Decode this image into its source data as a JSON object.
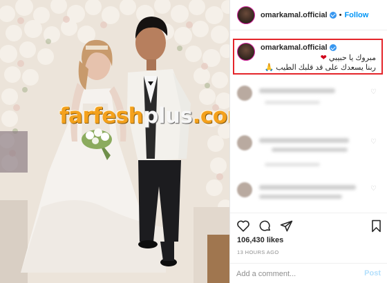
{
  "post": {
    "username": "omarkamal.official",
    "follow_label": "Follow",
    "separator": "•",
    "caption_line1": "مبروك يا حبيبي",
    "caption_line2": "ربنا يسعدك على قد قلبك الطيب",
    "caption_emoji_heart": "❤",
    "caption_emoji_pray": "🙏",
    "likes": "106,430 likes",
    "time_ago": "13 HOURS AGO",
    "comment_placeholder": "Add a comment...",
    "post_label": "Post"
  },
  "watermark": {
    "main": "farfesh",
    "plus": "plus",
    "suffix": ".com"
  },
  "colors": {
    "verified": "#3897f0",
    "follow": "#0095f6",
    "highlight_border": "#e4242a",
    "watermark": "#f4a11c"
  },
  "icons": [
    "verified-badge-icon",
    "heart-icon",
    "comment-icon",
    "share-icon",
    "bookmark-icon"
  ]
}
